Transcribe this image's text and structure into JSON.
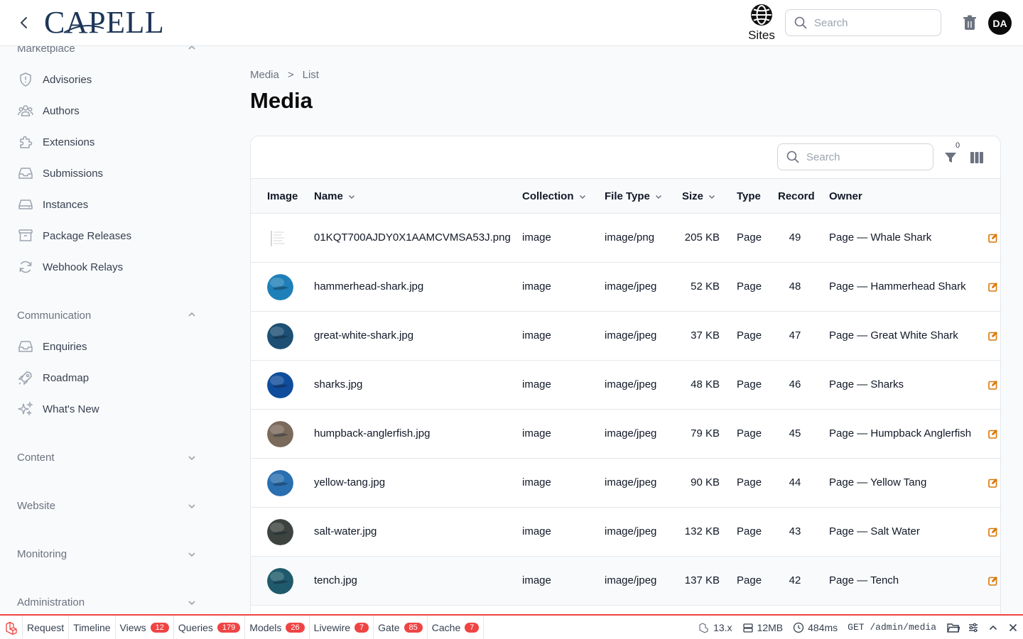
{
  "header": {
    "logo_text": "CAPELL",
    "sites_label": "Sites",
    "search_placeholder": "Search",
    "user_initials": "DA"
  },
  "sidebar": {
    "groups": [
      {
        "label": "Marketplace",
        "expanded": true,
        "items": [
          {
            "label": "Advisories",
            "icon": "shield-icon"
          },
          {
            "label": "Authors",
            "icon": "users-icon"
          },
          {
            "label": "Extensions",
            "icon": "puzzle-icon"
          },
          {
            "label": "Submissions",
            "icon": "inbox-icon"
          },
          {
            "label": "Instances",
            "icon": "server-icon"
          },
          {
            "label": "Package Releases",
            "icon": "archive-icon"
          },
          {
            "label": "Webhook Relays",
            "icon": "refresh-icon"
          }
        ]
      },
      {
        "label": "Communication",
        "expanded": true,
        "items": [
          {
            "label": "Enquiries",
            "icon": "inbox-icon"
          },
          {
            "label": "Roadmap",
            "icon": "rocket-icon"
          },
          {
            "label": "What's New",
            "icon": "sparkles-icon"
          }
        ]
      },
      {
        "label": "Content",
        "expanded": false,
        "items": []
      },
      {
        "label": "Website",
        "expanded": false,
        "items": []
      },
      {
        "label": "Monitoring",
        "expanded": false,
        "items": []
      },
      {
        "label": "Administration",
        "expanded": false,
        "items": []
      }
    ]
  },
  "breadcrumb": {
    "items": [
      "Media",
      "List"
    ],
    "separator": ">"
  },
  "page": {
    "title": "Media"
  },
  "table": {
    "search_placeholder": "Search",
    "filter_count": "0",
    "columns": [
      "Image",
      "Name",
      "Collection",
      "File Type",
      "Size",
      "Type",
      "Record",
      "Owner"
    ],
    "rows": [
      {
        "name": "01KQT700AJDY0X1AAMCVMSA53J.png",
        "collection": "image",
        "file_type": "image/png",
        "size": "205 KB",
        "type": "Page",
        "record": "49",
        "owner": "Page — Whale Shark",
        "thumb": "file"
      },
      {
        "name": "hammerhead-shark.jpg",
        "collection": "image",
        "file_type": "image/jpeg",
        "size": "52 KB",
        "type": "Page",
        "record": "48",
        "owner": "Page — Hammerhead Shark",
        "thumb": "#1f7fb8"
      },
      {
        "name": "great-white-shark.jpg",
        "collection": "image",
        "file_type": "image/jpeg",
        "size": "37 KB",
        "type": "Page",
        "record": "47",
        "owner": "Page — Great White Shark",
        "thumb": "#1c4f73"
      },
      {
        "name": "sharks.jpg",
        "collection": "image",
        "file_type": "image/jpeg",
        "size": "48 KB",
        "type": "Page",
        "record": "46",
        "owner": "Page — Sharks",
        "thumb": "#0f4c9c"
      },
      {
        "name": "humpback-anglerfish.jpg",
        "collection": "image",
        "file_type": "image/jpeg",
        "size": "79 KB",
        "type": "Page",
        "record": "45",
        "owner": "Page — Humpback Anglerfish",
        "thumb": "#7a6a5c"
      },
      {
        "name": "yellow-tang.jpg",
        "collection": "image",
        "file_type": "image/jpeg",
        "size": "90 KB",
        "type": "Page",
        "record": "44",
        "owner": "Page — Yellow Tang",
        "thumb": "#2a6fb0"
      },
      {
        "name": "salt-water.jpg",
        "collection": "image",
        "file_type": "image/jpeg",
        "size": "132 KB",
        "type": "Page",
        "record": "43",
        "owner": "Page — Salt Water",
        "thumb": "#3d4440"
      },
      {
        "name": "tench.jpg",
        "collection": "image",
        "file_type": "image/jpeg",
        "size": "137 KB",
        "type": "Page",
        "record": "42",
        "owner": "Page — Tench",
        "thumb": "#1e5a6b"
      }
    ]
  },
  "debugbar": {
    "tabs": [
      {
        "label": "Request",
        "badge": ""
      },
      {
        "label": "Timeline",
        "badge": ""
      },
      {
        "label": "Views",
        "badge": "12"
      },
      {
        "label": "Queries",
        "badge": "179"
      },
      {
        "label": "Models",
        "badge": "26"
      },
      {
        "label": "Livewire",
        "badge": "7"
      },
      {
        "label": "Gate",
        "badge": "85"
      },
      {
        "label": "Cache",
        "badge": "7"
      }
    ],
    "version": "13.x",
    "memory": "12MB",
    "duration": "484ms",
    "route": "GET /admin/media"
  },
  "colors": {
    "accent": "#d97706",
    "debug_red": "#ef4444",
    "logo": "#1d3557"
  }
}
